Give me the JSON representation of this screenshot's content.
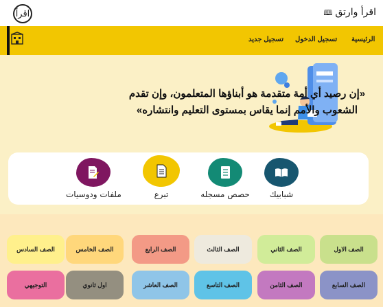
{
  "header": {
    "title": "اقرأ وارتق",
    "logo_text": "اقرأ"
  },
  "nav": {
    "home": "الرئيسية",
    "login": "تسجيل الدخول",
    "register": "تسجيل جديد"
  },
  "hero": {
    "quote": "«إن رصيد أي أمة متقدمة هو أبناؤها المتعلمون، وإن تقدم الشعوب والأمم إنما يقاس بمستوى التعليم وانتشاره»"
  },
  "features": [
    {
      "label": "شبابيك",
      "color": "#17566f",
      "icon": "book-open-icon"
    },
    {
      "label": "حصص مسجله",
      "color": "#138a75",
      "icon": "notebook-icon"
    },
    {
      "label": "تبرع",
      "color": "#f2c601",
      "icon": "document-icon"
    },
    {
      "label": "ملفات ودوسيات",
      "color": "#7f1660",
      "icon": "file-edit-icon"
    }
  ],
  "grades": {
    "row1": [
      {
        "label": "الصف الاول",
        "color": "#c9e08c"
      },
      {
        "label": "الصف الثاني",
        "color": "#d1ec99"
      },
      {
        "label": "الصف الثالث",
        "color": "#eeeade"
      },
      {
        "label": "الصف الرابع",
        "color": "#f39a86"
      },
      {
        "label": "الصف الخامس",
        "color": "#ffd77b"
      },
      {
        "label": "الصف السادس",
        "color": "#fff08c"
      }
    ],
    "row2": [
      {
        "label": "الصف السابع",
        "color": "#8b93c7"
      },
      {
        "label": "الصف الثامن",
        "color": "#c379c0"
      },
      {
        "label": "الصف التاسع",
        "color": "#5fc3e7"
      },
      {
        "label": "الصف العاشر",
        "color": "#8fc5e8"
      },
      {
        "label": "اول ثانوي",
        "color": "#948f80"
      },
      {
        "label": "التوجيهي",
        "color": "#ea6f9f"
      }
    ]
  }
}
